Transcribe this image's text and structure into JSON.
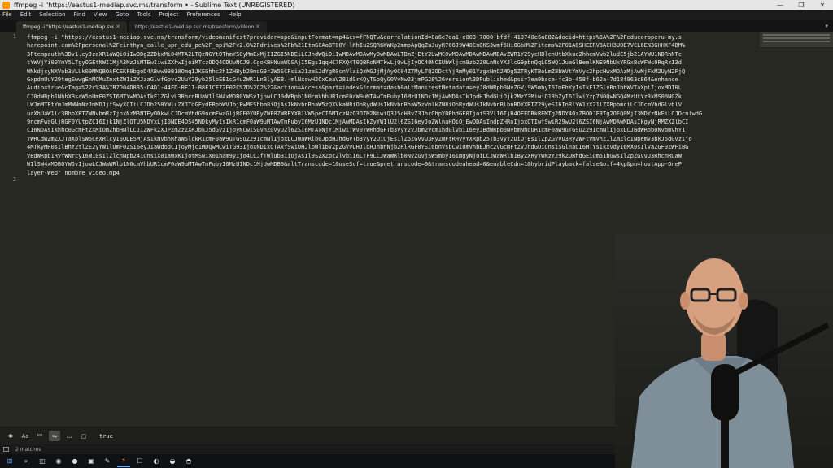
{
  "window": {
    "title": "ffmpeg -i \"https://eastus1-mediap.svc.ms/transform • - Sublime Text (UNREGISTERED)",
    "controls": {
      "minimize": "—",
      "maximize": "❐",
      "close": "✕"
    }
  },
  "menu": [
    "File",
    "Edit",
    "Selection",
    "Find",
    "View",
    "Goto",
    "Tools",
    "Project",
    "Preferences",
    "Help"
  ],
  "tabs": [
    {
      "label": "ffmpeg -i \"https://eastus1-mediap.svc.ms/transform",
      "close": "✕",
      "active": true
    },
    {
      "label": "https://eastus1-mediap.svc.ms/transform/videomanif",
      "close": "✕",
      "active": false
    }
  ],
  "editor": {
    "line_numbers": [
      "1",
      "2"
    ],
    "code_lines": [
      "ffmpeg -i \"https://eastus1-mediap.svc.ms/transform/videomanifest?provider=spo&inputFormat=mp4&cs=fFNQTw&correlationId=0a6e7da1-e003-7000-bfdf-419740e6a882&docid=https%3A%2F%2Feducorpperu-my.s",
      "harepoint.com%2Fpersonal%2Fcinthya_calle_upn_edu_pe%2F_api%2Fv2.0%2Fdrives%2Fb%21EtmGCAaBT0OY-lKhIu2SQR6KWKp2mmpApQqZuJuyR706J9W40CnQKS3wmf5HiOGbH%2Fitems%2F01AQSHEERV3ACH3UOE7VCL6EN3GHHXF4BM%",
      "3Ftempauth%3Dv1.eyJzaXR1aWQiOiIwODg2ZDkxMi04MTA2LTQzNGYtOThmYS0yMmExMjI1ZGI5NDEiLCJhdWQiOiIwMDAwMDAwMy0wMDAwLTBmZjEtY2UwMC0wMDAwMDAwMDAwMDAvZWR1Y29ycHBlcnUtbXkuc2hhcmVwb2ludC5jb21AYWU1NDRhNTc",
      "tYWVjYi00YmY5LTgyOGEtNWI1MjA3MzJiMTEwIiwiZXhwIjoiMTczODQ4ODUwNCJ9.CgoKBHNuaWQSAjI5EgsIqqHC7FXQ4T0QBRoNMTkwLjQwLjIyOC40NCIUbWljcm9zb2Z0LnNoYXJlcG9pbnQqLG5WQ1JuaGlBemlKNE9NbUxYRGxBcWFWc0RqRzI3d",
      "WNkdjcyNXVob3VLUk09MMQBOAFCEKF9bgoD4ABww99B10OmqIJKEGhhc2h1ZHByb29mdG9rZW5SCFsia21zaSJdYgR0cnVlaiQzMGJjMjAyOC04ZTMyLTQ2ODctYjRmMy01YzgxNmQ2MDg5ZTRyKTBoLmZ8bWVtYmVyc2hpcHwxMDAzMjAwMjFkM2UyN2FjQ",
      "GxpdmUuY29tegEwwgEnMCMuZnxtZW1iZXJzaGlwfGpvc2UuY29yb25lbEB1cG4uZWR1LnBlyAEB.-mlNxswH2OxCeaV281dSrKQyTSoQyG0VvNw23jmPG28%26version%3DPublished&psi=7ea9bace-fc3b-458f-b62a-7d18f963c864&enhance",
      "Audio=true&cTag=%22c%3A%7B7D04D835-C4D1-44FD-BF11-B8F1CF72F02C%7D%2C2%22&action=Access&part=index&format=dash&altManifestMetadata=eyJ0dWRpb0NvZGVjSW5mbyI6ImFhYyIsIkF1ZGlvRnJhbWVTaXplIjoxMDI0L",
      "CJ0dWRpb1NhbXBsaW5nUmF0ZSI6MTYwMDAsIkF1ZGlvU3RhcnRUaW1lSW4xMDB0YWSvIjowLCJ0dWRpb1N0cmVhbUR1cmF0aW9uMTAwTmFubyI6MzU1NDc1MjAwMDAsIkJpdHJhdGUiOjk2MzY3MiwiQ1RhZyI6IlwiYzp7N0QwNGQ4MzUtYzRkMS00NGZk",
      "LWJmMTEtYmJmMWNmNzJmMDJjfSwyXCIiLCJDb250YWluZXJTdGFydFRpbWVJbjEwMEShbm8iOjAsIkNvbnRhaW5zQXVkaW8iOnRydWUsIkNvbnRhaW5zVmlkZW8iOnRydWUsIkNvbnRlbnRDYXRIZ29yeSI6InRlYW1zX21lZXRpbmciLCJDcmVhdGlvblV",
      "uaXhUaW1lc3RhbXBTZWNvbmRzIjoxNzM3NTEyODkwLCJDcmVhdG9ncmFwaGljRGF0YURyZWF0ZWRFYXRlVW5peCI6MTczNzQ3OTM2NiwiQ3J5cHRvZ3JhcGhpY0RhdGF0IjoiS3VlI6IjB4OEEDRkREMTg2NDY4QzZBODJFRTg2OEQ0MjI3MDYzNkEiLCJDcnlwdG",
      "9ncmFwaGljRGF0YUtpZCI6Ijk1NjZlOTU5NDYxLjI0NDE4OS45NDkyMyIsIkR1cmF0aW9uMTAwTmFubyI6MzU1NDc1MjAwMDAsIkZyYW1lU2l6ZSI6eyJoZWlnaHQiOjEwODAsIndpZHRoIjoxOTIwfSwiR29wU2l6ZSI6NjAwMDAwMDAsIkgyNjRMZXZlbCI",
      "CI6NDAsIkhhc0GcmFtZXMiOmZhbHNlLCJIZWFkZXJPZmZzZXRJbkJ5dGVzIjoyNCwiSGVhZGVyU2l6ZSI6MTAxNjY1MiwiTWV0YWRhdGFTb3VyY2VJbm2vcm1hdGlvbiI6eyJBdWRpb0NvbmNhdUR1cmF0aW9uTG9uZ291cmNlIjoxLCJBdWRpb0NvbmVhY1",
      "YWRCdWZmZXJTaXplSW5CeXRlcyI6ODE5MjAsIkNvbnRhaW5lckR1cmF0aW9uTG9uZ291cmNlIjoxLCJWaWRlb0JpdHJhdGVTb3VyY2UiOjEsIlZpZGVvU3RyZWFtRHVyYXRpb25Tb3VyY2UiOjEsIlZpZGVvU3RyZWFtVmVhZ1lZmZlcINpemV3bkJ5dGVzIjo",
      "4MTkyMH0sIlBhY2tlZE2yYW1lUmF0ZSI6eyJIaWdodCIjoyMjc1MDQwMCwiTG93IjoxNDIxOTAxfSwiUHJlbWl1bVZpZGVvUHJldHJhbnNjb2RlRGF0YSI6bnVsbCwiUmVhbEJhc2VGcmFtZVJhdGUiOnsiSGlnaCI6MTYsIkxvdyI6MX0sIlVaZGF0ZWFiBG",
      "VBdWRpb1RyYWNrcyI6W10sIlZlcnNpb24iOnsiX01aWxKIjotMSwiX01ham9yIjo4LCJfTWlub3IiOjAsIl9SZXZpc2lvbiI6LTF9LCJWaWRlb0NvZGVjSW5mbyI6ImgyNjQiLCJWaWRlb1ByZXRyYWNzY29kZURhdGEiOm51bGwsIlZpZGVvU3RhcnRUaW",
      "W1lSW4xMDBOYW5vIjowLCJWaWRlb1N0cmVhbUR1cmF0aW9uMTAwTmFubyI6MzU1NDc1MjUwMDB9&altTranscode=1&useScf=true&pretranscode=0&transcodeahead=0&enableCdn=1&hybridPlayback=false&oif=4kp&pn=hostApp-OneP",
      "layer-Web\" nombre_video.mp4"
    ]
  },
  "find_panel": {
    "buttons": [
      "✱",
      "Aa",
      "\"\"",
      "⇋",
      "▭",
      "▢"
    ],
    "query": "true"
  },
  "status": {
    "matches": "2 matches"
  },
  "taskbar": {
    "items": [
      "⊞",
      "⌕",
      "◫",
      "◉",
      "●",
      "▣",
      "✎",
      "⚡",
      "☐",
      "◐",
      "◒",
      "◓"
    ]
  },
  "colors": {
    "editor_bg": "#272822",
    "text": "#e8e8e2",
    "accent": "#ff9800",
    "menubar": "#1b1b1b"
  }
}
